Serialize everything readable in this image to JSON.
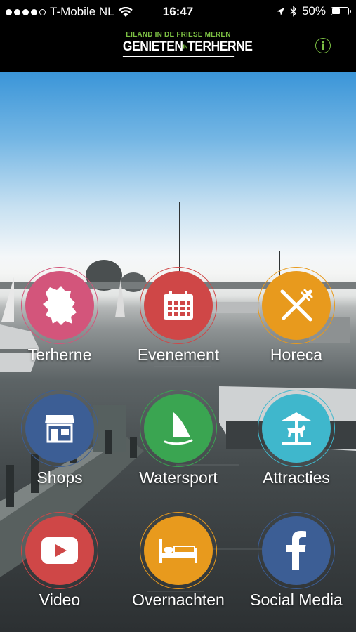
{
  "status_bar": {
    "carrier": "T-Mobile NL",
    "time": "16:47",
    "battery": "50%",
    "battery_level": 0.5,
    "signal_bars": 4
  },
  "header": {
    "logo_tagline": "EILAND IN DE FRIESE MEREN",
    "logo_left": "GENIETEN",
    "logo_in": "IN",
    "logo_right": "TERHERNE",
    "info_label": "i"
  },
  "colors": {
    "accent_green": "#7cc043",
    "pink": "#d3557b",
    "red": "#cf4747",
    "orange": "#e89a1d",
    "blue": "#3c5e95",
    "green": "#3aa551",
    "teal": "#3fb7cc"
  },
  "tiles": [
    {
      "label": "Terherne",
      "icon": "map-icon",
      "color": "#d3557b"
    },
    {
      "label": "Evenement",
      "icon": "calendar-icon",
      "color": "#cf4747"
    },
    {
      "label": "Horeca",
      "icon": "fork-knife-icon",
      "color": "#e89a1d"
    },
    {
      "label": "Shops",
      "icon": "shop-icon",
      "color": "#3c5e95"
    },
    {
      "label": "Watersport",
      "icon": "windsurf-icon",
      "color": "#3aa551"
    },
    {
      "label": "Attracties",
      "icon": "carousel-icon",
      "color": "#3fb7cc"
    },
    {
      "label": "Video",
      "icon": "youtube-icon",
      "color": "#cf4747"
    },
    {
      "label": "Overnachten",
      "icon": "bed-icon",
      "color": "#e89a1d"
    },
    {
      "label": "Social Media",
      "icon": "facebook-icon",
      "color": "#3c5e95"
    }
  ]
}
